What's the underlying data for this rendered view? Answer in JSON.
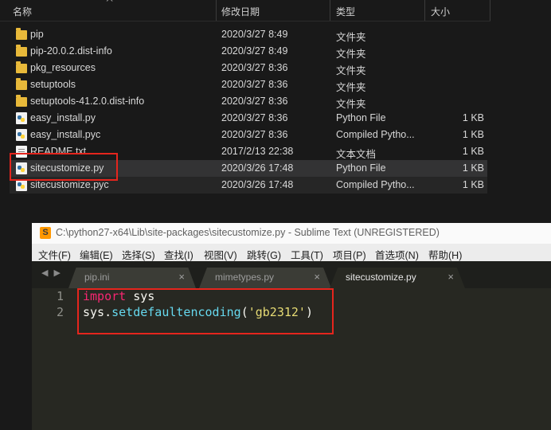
{
  "explorer": {
    "columns": {
      "name": "名称",
      "date": "修改日期",
      "type": "类型",
      "size": "大小"
    },
    "files": [
      {
        "icon": "folder-icon",
        "name": "pip",
        "date": "2020/3/27 8:49",
        "type": "文件夹",
        "size": ""
      },
      {
        "icon": "folder-icon",
        "name": "pip-20.0.2.dist-info",
        "date": "2020/3/27 8:49",
        "type": "文件夹",
        "size": ""
      },
      {
        "icon": "folder-icon",
        "name": "pkg_resources",
        "date": "2020/3/27 8:36",
        "type": "文件夹",
        "size": ""
      },
      {
        "icon": "folder-icon",
        "name": "setuptools",
        "date": "2020/3/27 8:36",
        "type": "文件夹",
        "size": ""
      },
      {
        "icon": "folder-icon",
        "name": "setuptools-41.2.0.dist-info",
        "date": "2020/3/27 8:36",
        "type": "文件夹",
        "size": ""
      },
      {
        "icon": "python-file-icon",
        "name": "easy_install.py",
        "date": "2020/3/27 8:36",
        "type": "Python File",
        "size": "1 KB"
      },
      {
        "icon": "python-file-icon",
        "name": "easy_install.pyc",
        "date": "2020/3/27 8:36",
        "type": "Compiled Pytho...",
        "size": "1 KB"
      },
      {
        "icon": "text-file-icon",
        "name": "README.txt",
        "date": "2017/2/13 22:38",
        "type": "文本文档",
        "size": "1 KB"
      },
      {
        "icon": "python-file-icon",
        "name": "sitecustomize.py",
        "date": "2020/3/26 17:48",
        "type": "Python File",
        "size": "1 KB"
      },
      {
        "icon": "python-file-icon",
        "name": "sitecustomize.pyc",
        "date": "2020/3/26 17:48",
        "type": "Compiled Pytho...",
        "size": "1 KB"
      }
    ]
  },
  "sublime": {
    "logo": "S",
    "title": "C:\\python27-x64\\Lib\\site-packages\\sitecustomize.py - Sublime Text (UNREGISTERED)",
    "menu": [
      "文件(F)",
      "编辑(E)",
      "选择(S)",
      "查找(I)",
      "视图(V)",
      "跳转(G)",
      "工具(T)",
      "项目(P)",
      "首选项(N)",
      "帮助(H)"
    ],
    "tab_arrows": "◀ ▶",
    "tabs": [
      {
        "label": "pip.ini",
        "close": "×"
      },
      {
        "label": "mimetypes.py",
        "close": "×"
      },
      {
        "label": "sitecustomize.py",
        "close": "×"
      }
    ],
    "code": {
      "line1_num": "1",
      "line1_kw": "import",
      "line1_rest": " sys",
      "line2_num": "2",
      "line2_obj": "sys.",
      "line2_fn": "setdefaultencoding",
      "line2_open": "(",
      "line2_str": "'gb2312'",
      "line2_close": ")"
    }
  },
  "colors": {
    "accent_red": "#e5251d",
    "editor_bg": "#272822",
    "keyword": "#f92672",
    "function": "#66d9ef",
    "string": "#e6db74"
  }
}
